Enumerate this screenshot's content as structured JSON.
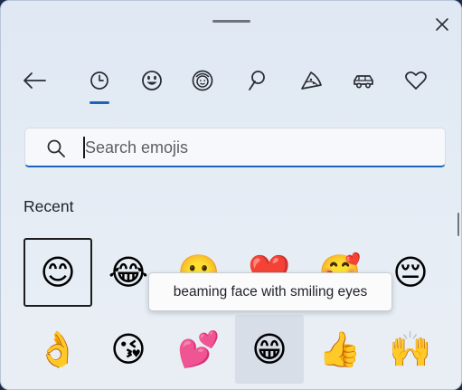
{
  "window": {
    "close_icon": "close-icon"
  },
  "nav": {
    "back_icon": "arrow-left-icon",
    "categories": [
      {
        "id": "recent",
        "icon": "clock-icon"
      },
      {
        "id": "smileys",
        "icon": "smiley-icon"
      },
      {
        "id": "people",
        "icon": "person-icon"
      },
      {
        "id": "nature",
        "icon": "leaf-icon"
      },
      {
        "id": "food",
        "icon": "pizza-icon"
      },
      {
        "id": "travel",
        "icon": "car-icon"
      },
      {
        "id": "symbols",
        "icon": "heart-icon"
      }
    ],
    "active_color": "#1b64b8"
  },
  "search": {
    "placeholder": "Search emojis",
    "value": ""
  },
  "section": {
    "title": "Recent"
  },
  "emojis": {
    "row1": [
      "😊",
      "😂",
      "🥲",
      "❤️",
      "🥰",
      "😔"
    ],
    "row2": [
      "👌",
      "😘",
      "💕",
      "😁",
      "👍",
      "🙌"
    ]
  },
  "tooltip": {
    "text": "beaming face with smiling eyes"
  }
}
